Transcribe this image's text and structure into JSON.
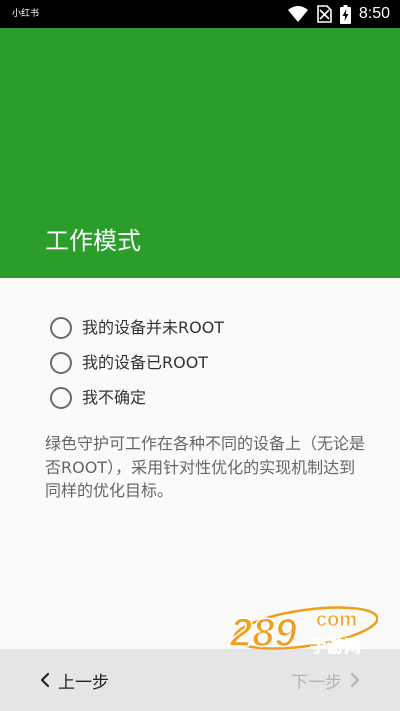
{
  "status_bar": {
    "carrier": "小红书",
    "time": "8:50",
    "icons": [
      "wifi-icon",
      "no-sim-icon",
      "battery-charging-icon"
    ]
  },
  "header": {
    "title": "工作模式",
    "background_color": "#2a9d2a"
  },
  "options": [
    {
      "label": "我的设备并未ROOT",
      "selected": false
    },
    {
      "label": "我的设备已ROOT",
      "selected": false
    },
    {
      "label": "我不确定",
      "selected": false
    }
  ],
  "description": "绿色守护可工作在各种不同的设备上（无论是否ROOT），采用针对性优化的实现机制达到同样的优化目标。",
  "footer": {
    "prev_label": "上一步",
    "next_label": "下一步",
    "prev_icon": "chevron-left-icon",
    "next_icon": "chevron-right-icon"
  },
  "watermark": {
    "brand": "289",
    "suffix": "com",
    "caption": "手游网"
  }
}
